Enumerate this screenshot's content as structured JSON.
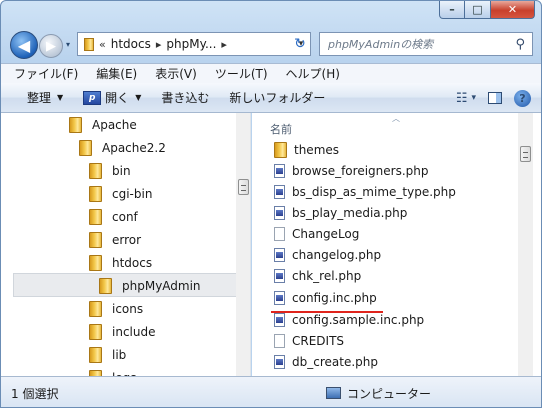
{
  "caption": {
    "minimize": "–",
    "maximize": "□",
    "close": "✕"
  },
  "nav": {
    "back": "◀",
    "forward": "▶",
    "dropdown": "▾"
  },
  "address": {
    "sep1": "«",
    "seg1": "htdocs",
    "sep2": "▸",
    "seg2": "phpMy...",
    "sep3": "▸",
    "dropdown": "▾"
  },
  "refresh": "↻",
  "search": {
    "placeholder": "phpMyAdminの検索",
    "icon": "search-icon"
  },
  "menu": [
    "ファイル(F)",
    "編集(E)",
    "表示(V)",
    "ツール(T)",
    "ヘルプ(H)"
  ],
  "toolbar": {
    "organize": "整理",
    "open": "開く",
    "burn": "書き込む",
    "new_folder": "新しいフォルダー",
    "views_arrow": "▾",
    "help": "?"
  },
  "tree": [
    {
      "label": "Apache"
    },
    {
      "label": "Apache2.2"
    },
    {
      "label": "bin"
    },
    {
      "label": "cgi-bin"
    },
    {
      "label": "conf"
    },
    {
      "label": "error"
    },
    {
      "label": "htdocs"
    },
    {
      "label": "phpMyAdmin",
      "selected": true
    },
    {
      "label": "icons"
    },
    {
      "label": "include"
    },
    {
      "label": "lib"
    },
    {
      "label": "logs"
    }
  ],
  "column_header": "名前",
  "files": [
    {
      "name": "themes",
      "type": "folder"
    },
    {
      "name": "browse_foreigners.php",
      "type": "php"
    },
    {
      "name": "bs_disp_as_mime_type.php",
      "type": "php"
    },
    {
      "name": "bs_play_media.php",
      "type": "php"
    },
    {
      "name": "ChangeLog",
      "type": "file"
    },
    {
      "name": "changelog.php",
      "type": "php"
    },
    {
      "name": "chk_rel.php",
      "type": "php"
    },
    {
      "name": "config.inc.php",
      "type": "php",
      "highlighted": true
    },
    {
      "name": "config.sample.inc.php",
      "type": "php"
    },
    {
      "name": "CREDITS",
      "type": "file"
    },
    {
      "name": "db_create.php",
      "type": "php"
    }
  ],
  "status": {
    "selection": "1 個選択",
    "location": "コンピューター"
  },
  "colors": {
    "highlight_underline": "#e0241c",
    "selection_bg": "#e9ebee"
  }
}
